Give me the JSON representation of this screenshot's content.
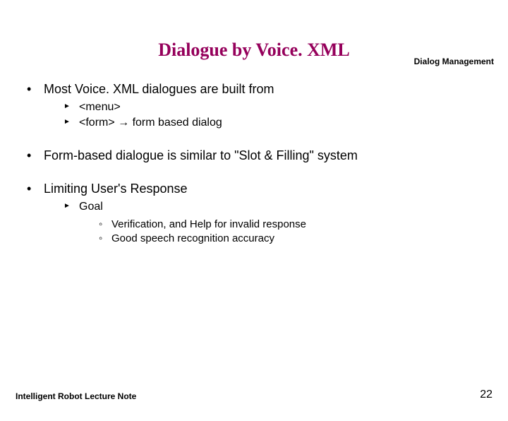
{
  "header": {
    "label": "Dialog Management"
  },
  "title": "Dialogue by Voice. XML",
  "body": {
    "items": [
      {
        "text": "Most Voice. XML dialogues are built from",
        "sub": [
          {
            "text": "<menu>"
          },
          {
            "text": "<form> → form based dialog"
          }
        ]
      },
      {
        "text": "Form-based dialogue is similar to \"Slot & Filling\" system"
      },
      {
        "text": "Limiting User's Response",
        "sub": [
          {
            "text": "Goal",
            "sub": [
              {
                "text": "Verification, and Help for invalid response"
              },
              {
                "text": "Good speech recognition accuracy"
              }
            ]
          }
        ]
      }
    ]
  },
  "footer": {
    "left": "Intelligent Robot Lecture Note",
    "page": "22"
  }
}
